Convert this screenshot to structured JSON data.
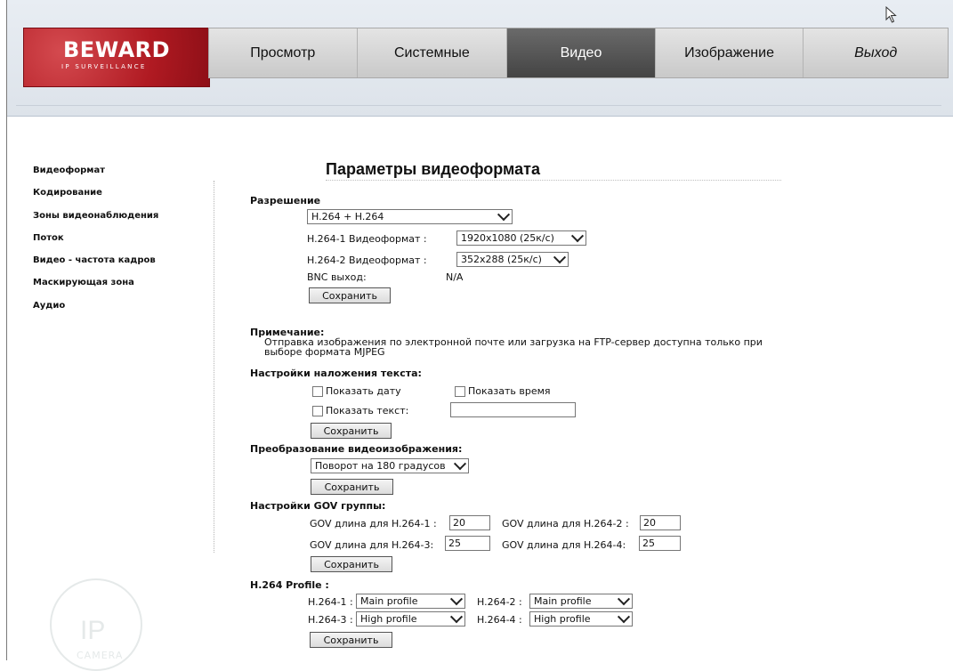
{
  "brand": {
    "name": "BEWARD",
    "tagline": "IP SURVEILLANCE"
  },
  "nav": [
    {
      "label": "Просмотр",
      "active": false
    },
    {
      "label": "Системные",
      "active": false
    },
    {
      "label": "Видео",
      "active": true
    },
    {
      "label": "Изображение",
      "active": false
    },
    {
      "label": "Выход",
      "active": false
    }
  ],
  "sidebar": [
    {
      "label": "Видеоформат"
    },
    {
      "label": "Кодирование"
    },
    {
      "label": "Зоны видеонаблюдения"
    },
    {
      "label": "Поток"
    },
    {
      "label": "Видео - частота кадров"
    },
    {
      "label": "Маскирующая зона"
    },
    {
      "label": "Аудио"
    }
  ],
  "page_title": "Параметры видеоформата",
  "resolution": {
    "heading": "Разрешение",
    "mode_value": "H.264 + H.264",
    "f1_label": "H.264-1 Видеоформат :",
    "f1_value": "1920x1080 (25к/с)",
    "f2_label": "H.264-2 Видеоформат :",
    "f2_value": "352x288 (25к/с)",
    "bnc_label": "BNC выход:",
    "bnc_value": "N/A",
    "save": "Сохранить"
  },
  "note": {
    "heading": "Примечание:",
    "text": "Отправка изображения по электронной почте или загрузка на FTP-сервер доступна только при выборе формата MJPEG"
  },
  "overlay": {
    "heading": "Настройки наложения текста:",
    "show_date": "Показать дату",
    "show_time": "Показать время",
    "show_text": "Показать текст:",
    "text_value": "",
    "save": "Сохранить"
  },
  "transform": {
    "heading": "Преобразование видеоизображения:",
    "value": "Поворот на 180 градусов",
    "save": "Сохранить"
  },
  "gov": {
    "heading": "Настройки GOV группы:",
    "l1": "GOV длина для H.264-1 :",
    "v1": "20",
    "l2": "GOV длина для H.264-2 :",
    "v2": "20",
    "l3": "GOV длина для H.264-3:",
    "v3": "25",
    "l4": "GOV длина для H.264-4:",
    "v4": "25",
    "save": "Сохранить"
  },
  "profile": {
    "heading": "H.264 Profile :",
    "l1": "H.264-1 :",
    "v1": "Main profile",
    "l2": "H.264-2 :",
    "v2": "Main profile",
    "l3": "H.264-3 :",
    "v3": "High profile",
    "l4": "H.264-4 :",
    "v4": "High profile",
    "save": "Сохранить"
  },
  "watermark": {
    "ip": "IP",
    "camera": "CAMERA"
  }
}
